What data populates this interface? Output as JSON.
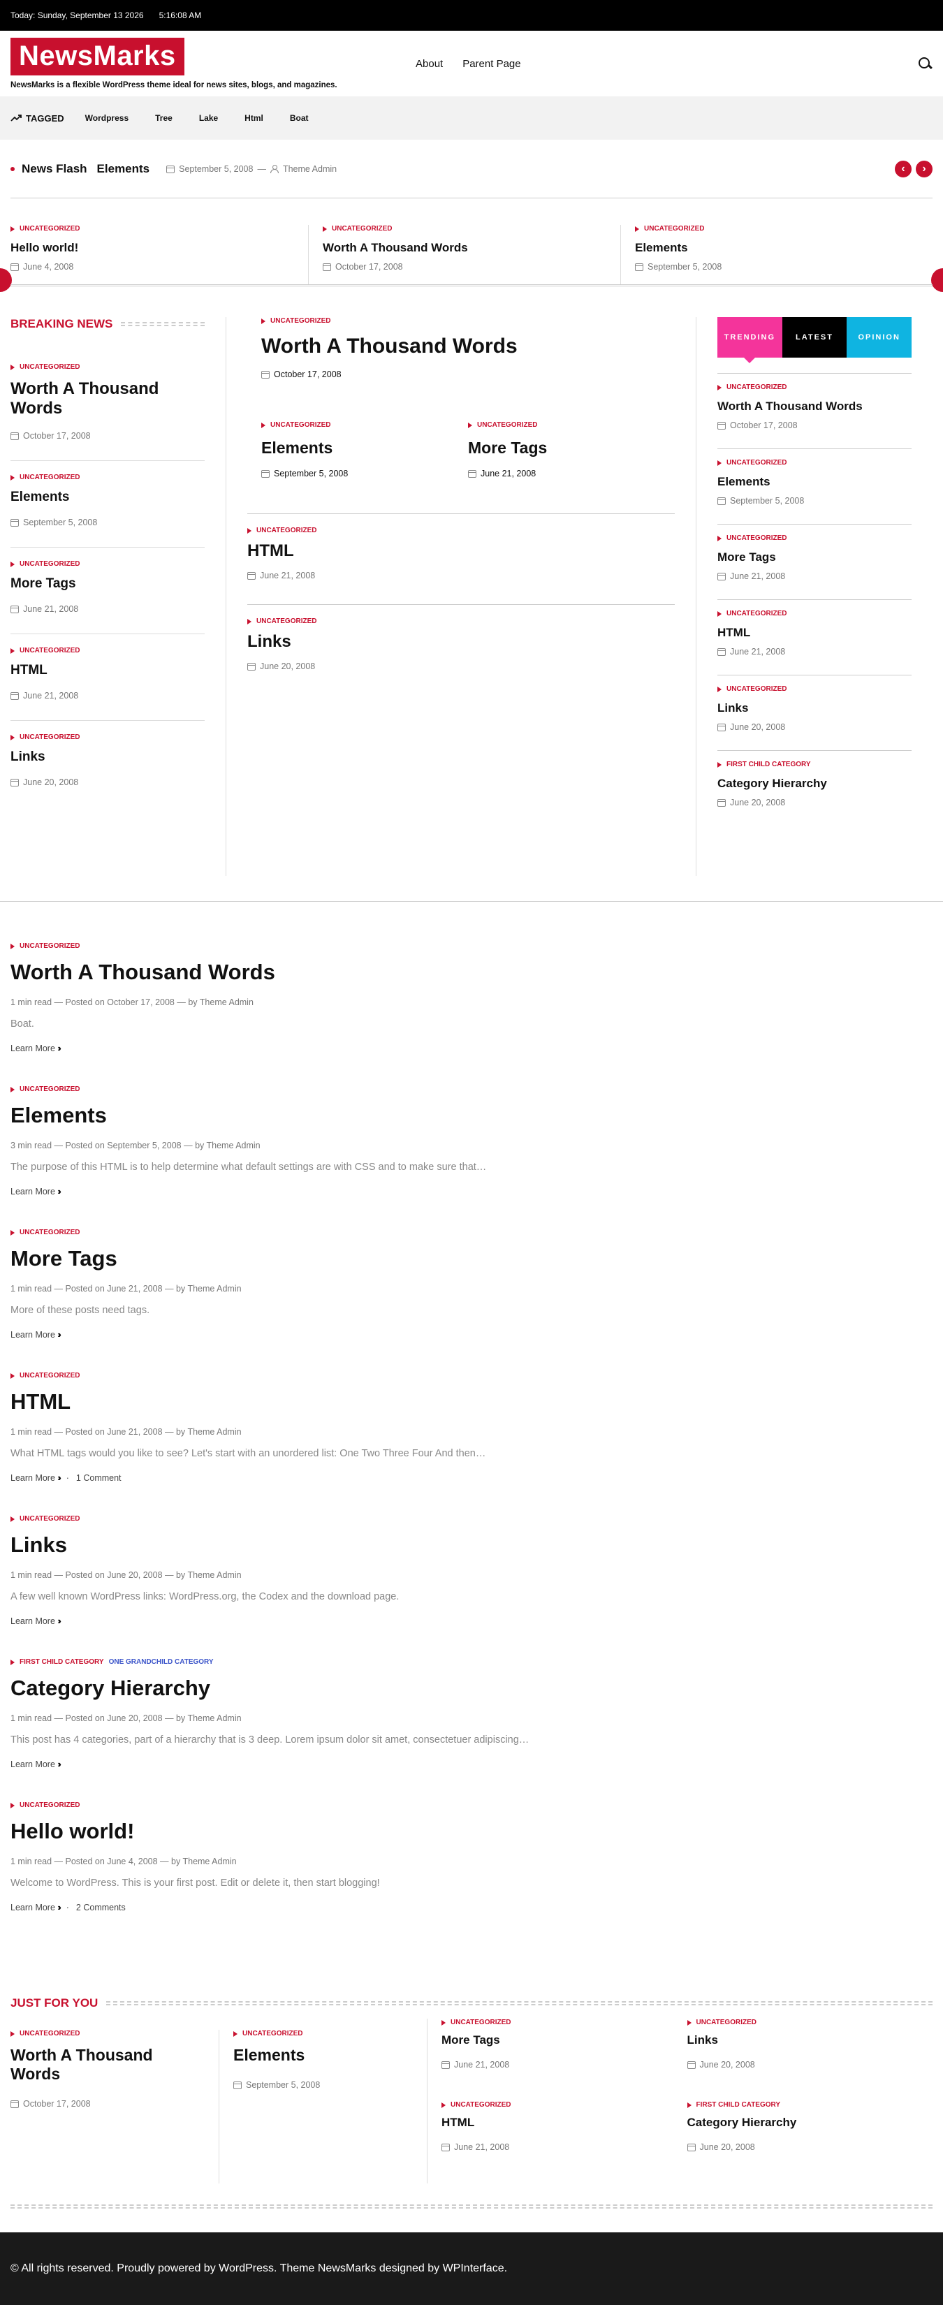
{
  "topbar": {
    "date": "Today: Sunday, September 13 2026",
    "time": "5:16:08 AM"
  },
  "header": {
    "logo": "NewsMarks",
    "tagline": "NewsMarks is a flexible WordPress theme ideal for news sites, blogs, and magazines.",
    "nav": [
      "About",
      "Parent Page"
    ]
  },
  "tagbar": {
    "label": "TAGGED",
    "tags": [
      "Wordpress",
      "Tree",
      "Lake",
      "Html",
      "Boat"
    ]
  },
  "flash": {
    "title": "News Flash",
    "item": "Elements",
    "date": "September 5, 2008",
    "author": "Theme Admin"
  },
  "slider": [
    {
      "cat": "UNCATEGORIZED",
      "title": "Hello world!",
      "date": "June 4, 2008"
    },
    {
      "cat": "UNCATEGORIZED",
      "title": "Worth A Thousand Words",
      "date": "October 17, 2008"
    },
    {
      "cat": "UNCATEGORIZED",
      "title": "Elements",
      "date": "September 5, 2008"
    }
  ],
  "breaking": {
    "title": "BREAKING NEWS",
    "items": [
      {
        "cat": "UNCATEGORIZED",
        "title": "Worth A Thousand Words",
        "date": "October 17, 2008"
      },
      {
        "cat": "UNCATEGORIZED",
        "title": "Elements",
        "date": "September 5, 2008"
      },
      {
        "cat": "UNCATEGORIZED",
        "title": "More Tags",
        "date": "June 21, 2008"
      },
      {
        "cat": "UNCATEGORIZED",
        "title": "HTML",
        "date": "June 21, 2008"
      },
      {
        "cat": "UNCATEGORIZED",
        "title": "Links",
        "date": "June 20, 2008"
      }
    ]
  },
  "middle": {
    "top": {
      "cat": "UNCATEGORIZED",
      "title": "Worth A Thousand Words",
      "date": "October 17, 2008"
    },
    "pair": [
      {
        "cat": "UNCATEGORIZED",
        "title": "Elements",
        "date": "September 5, 2008"
      },
      {
        "cat": "UNCATEGORIZED",
        "title": "More Tags",
        "date": "June 21, 2008"
      }
    ],
    "list": [
      {
        "cat": "UNCATEGORIZED",
        "title": "HTML",
        "date": "June 21, 2008"
      },
      {
        "cat": "UNCATEGORIZED",
        "title": "Links",
        "date": "June 20, 2008"
      }
    ]
  },
  "tabs": [
    "TRENDING",
    "LATEST",
    "OPINION"
  ],
  "trending": [
    {
      "cat": "UNCATEGORIZED",
      "title": "Worth A Thousand Words",
      "date": "October 17, 2008"
    },
    {
      "cat": "UNCATEGORIZED",
      "title": "Elements",
      "date": "September 5, 2008"
    },
    {
      "cat": "UNCATEGORIZED",
      "title": "More Tags",
      "date": "June 21, 2008"
    },
    {
      "cat": "UNCATEGORIZED",
      "title": "HTML",
      "date": "June 21, 2008"
    },
    {
      "cat": "UNCATEGORIZED",
      "title": "Links",
      "date": "June 20, 2008"
    },
    {
      "cat": "FIRST CHILD CATEGORY",
      "title": "Category Hierarchy",
      "date": "June 20, 2008"
    }
  ],
  "posts": [
    {
      "cats": [
        "UNCATEGORIZED"
      ],
      "title": "Worth A Thousand Words",
      "read": "1 min read",
      "posted": "Posted on October 17, 2008",
      "by": "by",
      "author": "Theme Admin",
      "excerpt": "Boat.",
      "more": "Learn More",
      "comments": ""
    },
    {
      "cats": [
        "UNCATEGORIZED"
      ],
      "title": "Elements",
      "read": "3 min read",
      "posted": "Posted on September 5, 2008",
      "by": "by",
      "author": "Theme Admin",
      "excerpt": "The purpose of this HTML is to help determine what default settings are with CSS and to make sure that…",
      "more": "Learn More",
      "comments": ""
    },
    {
      "cats": [
        "UNCATEGORIZED"
      ],
      "title": "More Tags",
      "read": "1 min read",
      "posted": "Posted on June 21, 2008",
      "by": "by",
      "author": "Theme Admin",
      "excerpt": "More of these posts need tags.",
      "more": "Learn More",
      "comments": ""
    },
    {
      "cats": [
        "UNCATEGORIZED"
      ],
      "title": "HTML",
      "read": "1 min read",
      "posted": "Posted on June 21, 2008",
      "by": "by",
      "author": "Theme Admin",
      "excerpt": "What HTML tags would you like to see? Let's start with an unordered list: One Two Three Four And then…",
      "more": "Learn More",
      "comments": "1 Comment"
    },
    {
      "cats": [
        "UNCATEGORIZED"
      ],
      "title": "Links",
      "read": "1 min read",
      "posted": "Posted on June 20, 2008",
      "by": "by",
      "author": "Theme Admin",
      "excerpt": "A few well known WordPress links: WordPress.org, the Codex and the download page.",
      "more": "Learn More",
      "comments": ""
    },
    {
      "cats": [
        "FIRST CHILD CATEGORY",
        "ONE GRANDCHILD CATEGORY"
      ],
      "title": "Category Hierarchy",
      "read": "1 min read",
      "posted": "Posted on June 20, 2008",
      "by": "by",
      "author": "Theme Admin",
      "excerpt": "This post has 4 categories, part of a hierarchy that is 3 deep. Lorem ipsum dolor sit amet, consectetuer adipiscing…",
      "more": "Learn More",
      "comments": ""
    },
    {
      "cats": [
        "UNCATEGORIZED"
      ],
      "title": "Hello world!",
      "read": "1 min read",
      "posted": "Posted on June 4, 2008",
      "by": "by",
      "author": "Theme Admin",
      "excerpt": "Welcome to WordPress. This is your first post. Edit or delete it, then start blogging!",
      "more": "Learn More",
      "comments": "2 Comments"
    }
  ],
  "jfy": {
    "title": "JUST FOR YOU",
    "big": [
      {
        "cat": "UNCATEGORIZED",
        "title": "Worth A Thousand Words",
        "date": "October 17, 2008"
      },
      {
        "cat": "UNCATEGORIZED",
        "title": "Elements",
        "date": "September 5, 2008"
      }
    ],
    "small": [
      {
        "cat": "UNCATEGORIZED",
        "title": "More Tags",
        "date": "June 21, 2008"
      },
      {
        "cat": "UNCATEGORIZED",
        "title": "Links",
        "date": "June 20, 2008"
      },
      {
        "cat": "UNCATEGORIZED",
        "title": "HTML",
        "date": "June 21, 2008"
      },
      {
        "cat": "FIRST CHILD CATEGORY",
        "title": "Category Hierarchy",
        "date": "June 20, 2008"
      }
    ]
  },
  "footer": {
    "text": "© All rights reserved. Proudly powered by WordPress. Theme NewsMarks designed by WPInterface."
  },
  "colors": {
    "accent": "#c8102e",
    "trending": "#f4349b",
    "opinion": "#0fb4e1"
  }
}
